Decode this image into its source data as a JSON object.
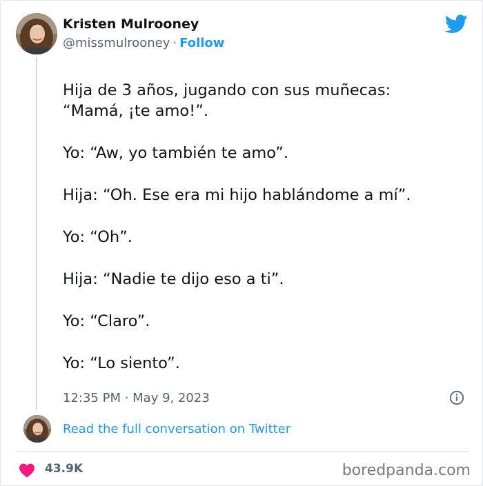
{
  "author": {
    "name": "Kristen Mulrooney",
    "handle": "@missmulrooney",
    "separator": "·",
    "follow_label": "Follow"
  },
  "tweet": {
    "lines": [
      "Hija de 3 años, jugando con sus muñecas:",
      "“Mamá, ¡te amo!”.",
      "Yo: “Aw, yo también te amo”.",
      "Hija: “Oh. Ese era mi hijo hablándome a mí”.",
      "Yo: “Oh”.",
      "Hija: “Nadie te dijo eso a ti”.",
      "Yo: “Claro”.",
      "Yo: “Lo siento”."
    ],
    "timestamp": "12:35 PM · May 9, 2023"
  },
  "conversation_link": "Read the full conversation on Twitter",
  "likes": {
    "count": "43.9K",
    "icon": "heart-icon",
    "color": "#f91880"
  },
  "icons": {
    "brand": "twitter-bird-icon",
    "info": "info-icon"
  },
  "colors": {
    "accent": "#1d9bf0",
    "text": "#0f1419",
    "muted": "#536471",
    "border": "#cfd9de"
  },
  "watermark": "boredpanda.com"
}
